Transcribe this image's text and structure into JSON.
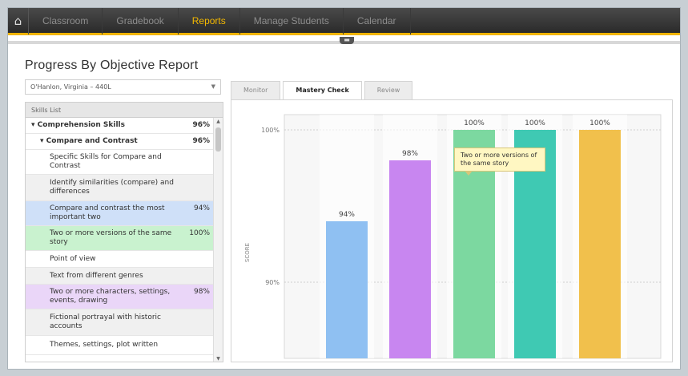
{
  "nav": {
    "home_icon": "home-icon",
    "items": [
      "Classroom",
      "Gradebook",
      "Reports",
      "Manage Students",
      "Calendar"
    ],
    "active": "Reports"
  },
  "page": {
    "title": "Progress By Objective Report",
    "student_selected": "O'Hanlon, Virginia – 440L"
  },
  "skills_list": {
    "header": "Skills List",
    "rows": [
      {
        "label": "Comprehension Skills",
        "pct": "96%",
        "level": 1,
        "bold": true,
        "expanded": true,
        "color": "#ffffff"
      },
      {
        "label": "Compare and Contrast",
        "pct": "96%",
        "level": 2,
        "bold": true,
        "expanded": true,
        "color": "#ffffff"
      },
      {
        "label": "Specific Skills for Compare and Contrast",
        "pct": "",
        "level": 3,
        "bold": false,
        "color": "#ffffff"
      },
      {
        "label": "Identify similarities (compare) and differences",
        "pct": "",
        "level": 3,
        "bold": false,
        "color": "#f0f0f0"
      },
      {
        "label": "Compare and contrast the most important two",
        "pct": "94%",
        "level": 3,
        "bold": false,
        "color": "#cfe0f8"
      },
      {
        "label": "Two or more versions of the same story",
        "pct": "100%",
        "level": 3,
        "bold": false,
        "color": "#c9f2cf"
      },
      {
        "label": "Point of view",
        "pct": "",
        "level": 3,
        "bold": false,
        "color": "#ffffff"
      },
      {
        "label": "Text from different genres",
        "pct": "",
        "level": 3,
        "bold": false,
        "color": "#f0f0f0"
      },
      {
        "label": "Two or more characters, settings, events, drawing",
        "pct": "98%",
        "level": 3,
        "bold": false,
        "color": "#ead6f8"
      },
      {
        "label": "Fictional portrayal with historic accounts",
        "pct": "",
        "level": 3,
        "bold": false,
        "color": "#f0f0f0"
      },
      {
        "label": "Themes, settings, plot written",
        "pct": "",
        "level": 3,
        "bold": false,
        "color": "#ffffff"
      }
    ]
  },
  "tabs": [
    {
      "label": "Monitor",
      "active": false
    },
    {
      "label": "Mastery Check",
      "active": true
    },
    {
      "label": "Review",
      "active": false
    }
  ],
  "tooltip": "Two or more versions of the same story",
  "chart_data": {
    "type": "bar",
    "ylabel": "SCORE",
    "y_ticks": [
      "100%",
      "90%"
    ],
    "ylim": [
      85,
      101
    ],
    "grid": true,
    "categories": [
      "Compare and contrast the most important two",
      "Two or more characters, settings, events, drawing",
      "Two or more versions of the same story",
      "",
      ""
    ],
    "values": [
      94,
      98,
      100,
      100,
      100
    ],
    "labels": [
      "94%",
      "98%",
      "100%",
      "100%",
      "100%"
    ],
    "colors": [
      "#8fc0f2",
      "#c886f0",
      "#7cd8a0",
      "#3fc9b3",
      "#f1c04c"
    ]
  }
}
